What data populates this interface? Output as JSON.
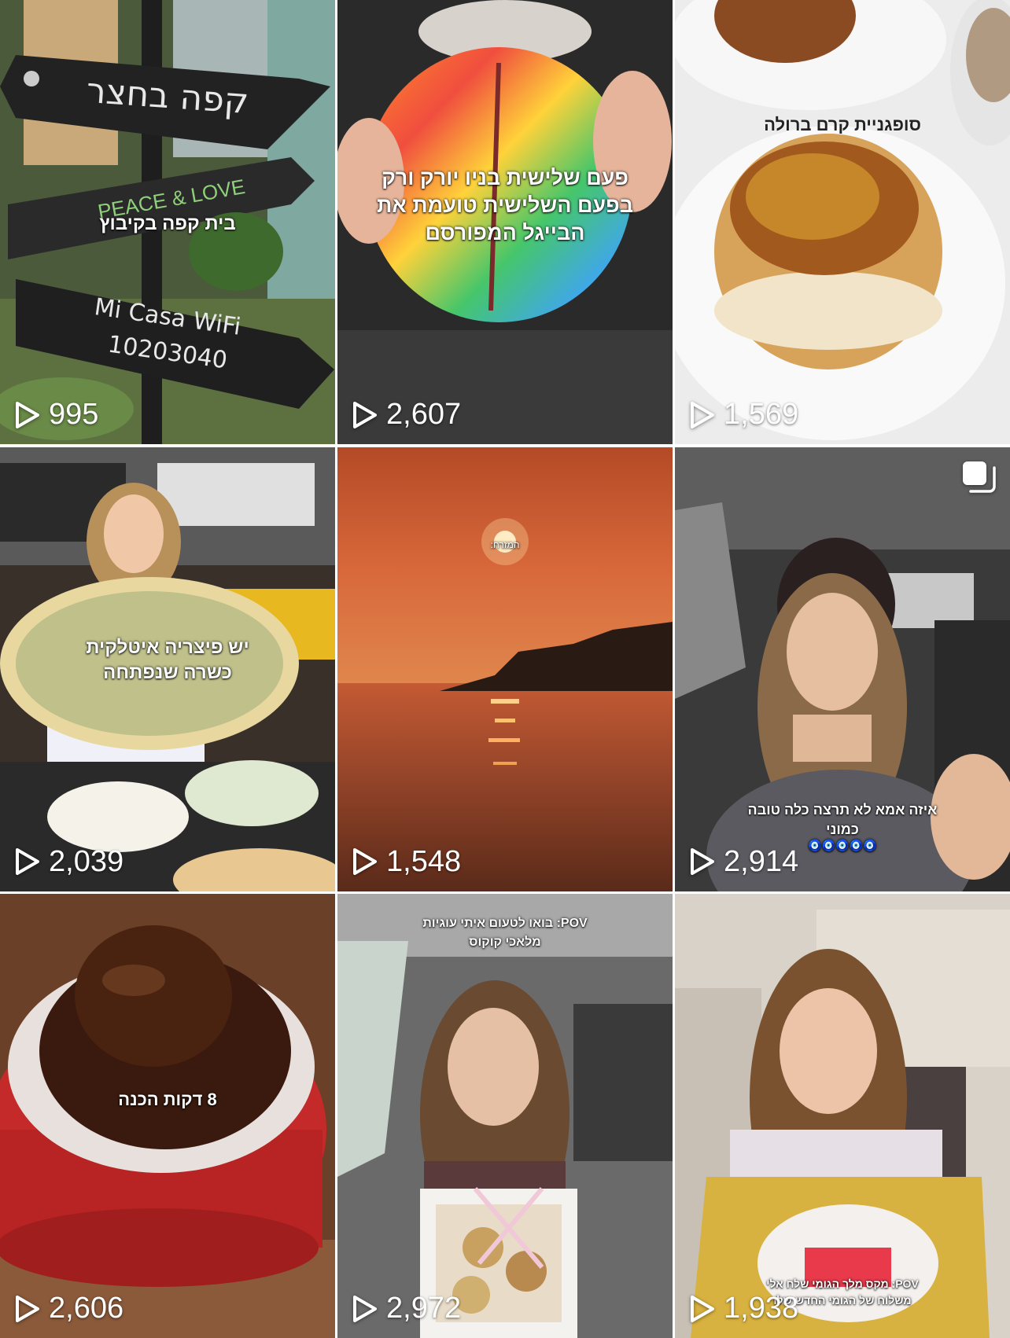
{
  "grid": {
    "posts": [
      {
        "views": "995",
        "caption": "בית קפה בקיבוץ",
        "sign_top": "קפה בחצר",
        "sign_mid": "PEACE & LOVE",
        "sign_bottom_1": "Mi Casa WiFi",
        "sign_bottom_2": "10203040"
      },
      {
        "views": "2,607",
        "caption_1": "פעם שלישית בניו יורק ורק",
        "caption_2": "בפעם השלישית טועמת את",
        "caption_3": "הבייגל המפורסם"
      },
      {
        "views": "1,569",
        "caption": "סופגניית קרם ברולה"
      },
      {
        "views": "2,039",
        "caption_1": "יש פיצריה איטלקית",
        "caption_2": "כשרה שנפתחה"
      },
      {
        "views": "1,548",
        "caption": "המזרח:"
      },
      {
        "views": "2,914",
        "caption_1": "איזה אמא לא תרצה כלה טובה",
        "caption_2": "כמוני",
        "caption_3": "🧿🧿🧿🧿🧿"
      },
      {
        "views": "2,606",
        "caption": "8 דקות הכנה"
      },
      {
        "views": "2,972",
        "caption_1": "POV: בואו לטעום איתי עוגיות",
        "caption_2": "מלאכי קוקוס"
      },
      {
        "views": "1,938",
        "caption_1": "POV: מקס מלך הגומי שלח אלי",
        "caption_2": "משלוח של הגומי החדש שלו"
      }
    ]
  },
  "colors": {
    "overlay_text": "#ffffff",
    "background": "#ffffff"
  }
}
